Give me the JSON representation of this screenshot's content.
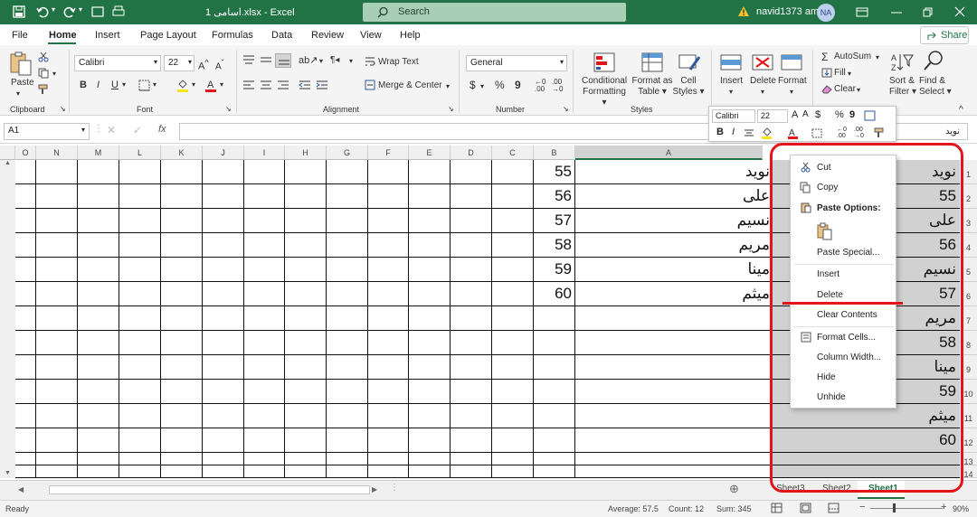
{
  "titlebar": {
    "filename": "اسامی 1.xlsx",
    "dash": "-",
    "app": "Excel",
    "search": "Search",
    "warning_user": "navid1373 amz",
    "initials": "NA"
  },
  "menu": {
    "file": "File",
    "home": "Home",
    "insert": "Insert",
    "page_layout": "Page Layout",
    "formulas": "Formulas",
    "data": "Data",
    "review": "Review",
    "view": "View",
    "help": "Help",
    "share": "Share"
  },
  "ribbon": {
    "paste": "Paste",
    "clipboard": "Clipboard",
    "font_name": "Calibri",
    "font_size": "22",
    "font": "Font",
    "wrap_text": "Wrap Text",
    "merge_center": "Merge & Center",
    "alignment": "Alignment",
    "number_format": "General",
    "number": "Number",
    "conditional": "Conditional",
    "formatting": "Formatting",
    "format_as": "Format as",
    "table": "Table",
    "cell": "Cell",
    "styles_btn": "Styles",
    "styles": "Styles",
    "insert": "Insert",
    "delete": "Delete",
    "format": "Format",
    "autosum": "AutoSum",
    "fill": "Fill",
    "clear": "Clear",
    "sort": "Sort &",
    "filter": "Filter",
    "find": "Find &",
    "select": "Select"
  },
  "formula": {
    "name_box": "A1",
    "fx": "fx",
    "value": "نوید"
  },
  "columns": [
    "O",
    "N",
    "M",
    "L",
    "K",
    "J",
    "I",
    "H",
    "G",
    "F",
    "E",
    "D",
    "C",
    "B",
    "A"
  ],
  "rows": [
    "1",
    "2",
    "3",
    "4",
    "5",
    "6",
    "7",
    "8",
    "9",
    "10",
    "11",
    "12",
    "13",
    "14"
  ],
  "col_c": [
    "55",
    "56",
    "57",
    "58",
    "59",
    "60"
  ],
  "col_b": [
    "نوید",
    "علی",
    "نسیم",
    "مریم",
    "مینا",
    "میثم"
  ],
  "col_a": [
    "نوید",
    "55",
    "علی",
    "56",
    "نسیم",
    "57",
    "مریم",
    "58",
    "مینا",
    "59",
    "میثم",
    "60"
  ],
  "mini": {
    "font": "Calibri",
    "size": "22"
  },
  "context": {
    "cut": "Cut",
    "copy": "Copy",
    "paste_options": "Paste Options:",
    "paste_special": "Paste Special...",
    "insert": "Insert",
    "delete": "Delete",
    "clear_contents": "Clear Contents",
    "format_cells": "Format Cells...",
    "column_width": "Column Width...",
    "hide": "Hide",
    "unhide": "Unhide"
  },
  "sheets": [
    "Sheet3",
    "Sheet2",
    "Sheet1"
  ],
  "status": {
    "ready": "Ready",
    "average": "Average: 57.5",
    "count": "Count: 12",
    "sum": "Sum: 345",
    "zoom": "90%"
  },
  "colors": {
    "excel_green": "#217346",
    "highlight_red": "#e3141c",
    "selection_grey": "#d1d1d1"
  }
}
